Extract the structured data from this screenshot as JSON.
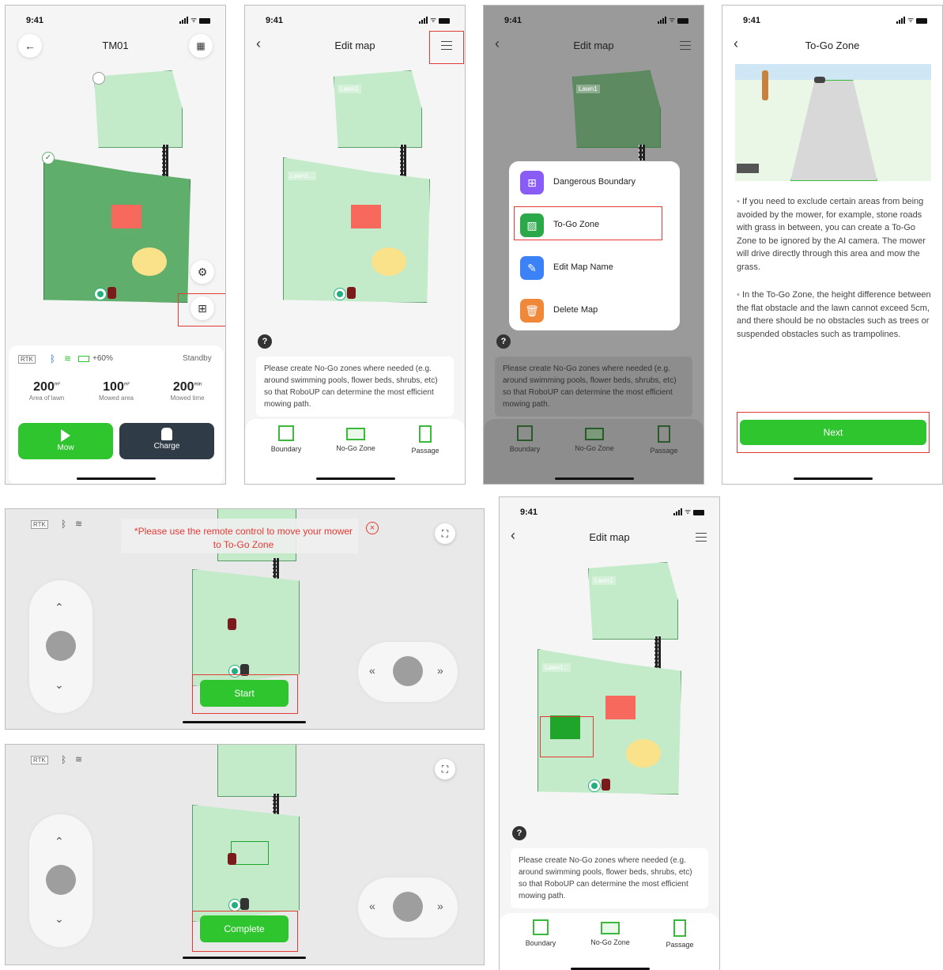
{
  "status_time": "9:41",
  "screen1": {
    "title": "TM01",
    "rtk": "RTK",
    "battery": "+60%",
    "state": "Standby",
    "stats": [
      {
        "value": "200",
        "unit": "m²",
        "label": "Area of lawn"
      },
      {
        "value": "100",
        "unit": "m²",
        "label": "Mowed area"
      },
      {
        "value": "200",
        "unit": "min",
        "label": "Mowed time"
      }
    ],
    "mow_label": "Mow",
    "charge_label": "Charge"
  },
  "edit_map": {
    "title": "Edit map",
    "lawn1_tag": "Lawn1",
    "lawn2_tag": "Lawn1...",
    "hint": "Please create No-Go zones where needed (e.g. around swimming pools, flower beds, shrubs, etc) so that  RoboUP can determine the most efficient mowing path.",
    "tools": [
      "Boundary",
      "No-Go Zone",
      "Passage"
    ],
    "qmark": "?"
  },
  "menu": {
    "items": [
      "Dangerous Boundary",
      "To-Go Zone",
      "Edit Map Name",
      "Delete Map"
    ]
  },
  "togo": {
    "title": "To-Go Zone",
    "bullet1": "If you need to exclude certain areas from being avoided by the mower, for example, stone roads with grass in between, you can create a To-Go Zone to be ignored by the AI camera. The mower will drive directly through this area and mow the grass.",
    "bullet2": "In the To-Go Zone, the height difference between the flat obstacle and the lawn cannot exceed 5cm, and there should be no obstacles such as trees or suspended obstacles such as trampolines.",
    "next_label": "Next"
  },
  "remote1": {
    "rtk": "RTK",
    "warning": "*Please use the remote control to move your mower to To-Go Zone",
    "start_label": "Start"
  },
  "remote2": {
    "rtk": "RTK",
    "complete_label": "Complete"
  },
  "colors": {
    "accent_green": "#2ec52e",
    "lawn_light": "#c3ebca",
    "lawn_dark": "#5fae6b",
    "danger_red": "#e53935"
  }
}
